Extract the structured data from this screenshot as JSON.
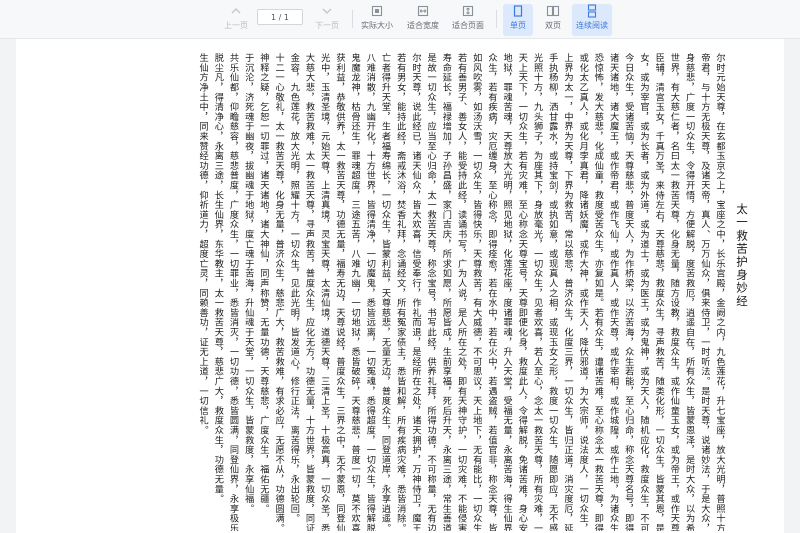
{
  "toolbar": {
    "prev_label": "上一页",
    "page_indicator": "1 / 1",
    "next_label": "下一页",
    "actual_size_label": "实际大小",
    "fit_width_label": "适合宽度",
    "fit_page_label": "适合页面",
    "single_page_label": "单页",
    "double_page_label": "双页",
    "continuous_label": "连续阅读",
    "accent_color": "#3b7be0"
  },
  "document": {
    "title": "太一救苦护身妙经",
    "columns": [
      "尔时元始天尊，在玄都玉京之上，宝座之中，长乐宫殿，金阙之内，九色莲花，升七宝座，放大光明，普照十方，与无数众",
      "帝君，与十方无极天尊，及诸天帝，真人、万万仙众，俱来侍卫，一时听法。是时天尊，说诸妙法，于是大众，欢喜踊跃，道",
      "身慈悲，广度一切众生，令得开悟，方便解脱，度苦救厄，逍遥自在，所有众生，皆蒙恩泽，是时大众，以为希有，天尊",
      "世界，有大慈仁者，名曰太一救苦天尊，化身无量，随方设教，救度众生，或作仙童玉女，或为帝王，或作天尊，普济众生",
      "臣辅，清宫玉女，千真万圣，来侍左右，天尊慈悲，救度众生，寻声救苦，随类化形，一切众生，皆蒙其恩，是以一心，",
      "女，或为宰官，或为长者，或为外道，或为道士，或为医王，或为鬼神，或为天人，随机应化，救度众生，不可思议。",
      "今日众生，受诸苦恼，天尊慈悲，普度天人，为作桥梁，以济苦海，众生若能，至心归命，称念天尊名号，即得解脱。",
      "诸天诸地，诸大魔王，或作帝君，或作飞仙，或作真人，或作天尊，或作宰相，或作城隍，或作土地，为诸众生，说法开化。",
      "恐惊怖，发大慈悲，化成仙童，救度受苦众生，亦复如是。若有众生，遭诸苦难，至心称念太一救苦天尊，即得离苦。",
      "或化太乙真人，或化月孛真君，降诸妖魔，或作大神，或作天人，降伏邪道，为大宗师，说法度人，一切众生，皆得解脱。",
      "上界为太一，中界为天尊，下界为救苦，常以慈悲，普济众生，化度三界，一切众生，皆归正道，消灾度厄，延生保命。",
      "手执杨柳，洒甘露水，或持宝剑，或执如意，或现真人之相，或现玉女之形，救度一切众生，随愿即应，无不感通。",
      "光照十方，九头狮子，为座其下，身放毫光，一切众生，见者欢喜，若人至心，念太一救苦天尊，所有灾难，一时消灭。",
      "天上天下，一切众生，若有灾难，至心称念天尊宝号，天尊即便化身，救度此人，令得解脱，免诸苦难，身心安乐。",
      "地狱，罪魂苦魂，天尊放大光明，照见地狱，化莲花座，度诸罪魂，升入天堂，受福无量，永离苦海，得生仙界。",
      "众生，若有疾病，灾厄缠身，至心称念，即得痊愈，若在水中，若在火中，若遇盗贼，若值官非，称念天尊，皆得解脱。",
      "如风吹雾，如汤沃雪，一切众生，皆得快乐，天尊救苦，有大威德，不可思议，天上地下，无有能比，一切众生，应当归依。",
      "若有善男子、善女人，能受持此经，读诵书写，广为人说，是人所在之处，即有天神守护，一切灾难，不能侵害。",
      "寿命延长，福禄增加，子孙昌盛，家门吉庆，所求如愿，所愿皆成，生前享福，死后升天，永离三途，常生善道。",
      "是故一切众生，应当至心归命，太一救苦天尊，称念宝号，书写此经，供养礼拜，所得功德，不可称量，无有边际。",
      "尔时天尊，说此经已，诸天仙众，皆大欢喜，信受奉行，作礼而退，是经所在之处，诸天拥护，万神侍卫，魔王敬伏。",
      "若有男女，能持此经，斋戒沐浴，焚香礼拜，念诵经文，所有冤家债主，悉皆和解，所有疾病灾难，悉皆消除。",
      "亡者得升天堂，生者福寿绵长，一切众生，皆蒙利益，天尊慈悲，无量无边，普度众生，同登道岸，永享逍遥。",
      "八难消散，九幽开化，十方世界，皆得清净，一切魔鬼，悉皆远离，一切冤魂，悉得超度，一切众生，皆得解脱。",
      "鬼魔龙神，枯骨还生，罪魂超度，三途五苦，八难九幽，一切地狱，悉皆破碎，天尊慈悲，普度一切，莫不欢喜。",
      "获利益，恭敬供养，太一救苦天尊，功德无量，福寿无边，天尊说经，普度众生，三界之中，无不蒙恩，同登仙界。",
      "光中，玉清圣境，元始天尊，上清真境，灵宝天尊，太清仙境，道德天尊，三清上圣，十极高真，一切众圣，悉皆降临。",
      "大慈大悲，救苦救难，太一救苦天尊，寻声救苦，普度众生，应化无方，功德无量，十方世界，皆蒙救度，同证真常。",
      "金容，九色莲花，放大光明，照耀十方，一切众生，见此光明，皆发道心，修行正法，离苦得乐，永出轮回。",
      "十二一心敬礼，太一救苦天尊，化身无量，普济众生，慈悲广大，救苦救难，有求必应，无愿不从，功德圆满。",
      "神释之疑，乞恕一切罪过，诸天诸地，诸大神仙，同声称赞，无量功德，天尊慈悲，广度众生，福佑无疆。",
      "于沉沦，济死魂于幽夜，拔幽魂于地狱，度亡魂于苦海，升仙魂于天堂，一切众生，皆蒙救度，永享仙福。",
      "共乐仙都，仰瞻慈容，慈悲普度，广度众生，一切罪业，悉皆消灭，一切功德，悉皆圆满，同登仙界，永享极乐。",
      "脱尘凡，得清净心，永离三途，长生仙界，东华教主，太一救苦天尊，慈悲广大，救度众生，功德无量。",
      "生仙方净土中，同来赞经功德，仰祈道力，超度亡灵，同赖善功，证无上道，一切信礼。"
    ]
  }
}
